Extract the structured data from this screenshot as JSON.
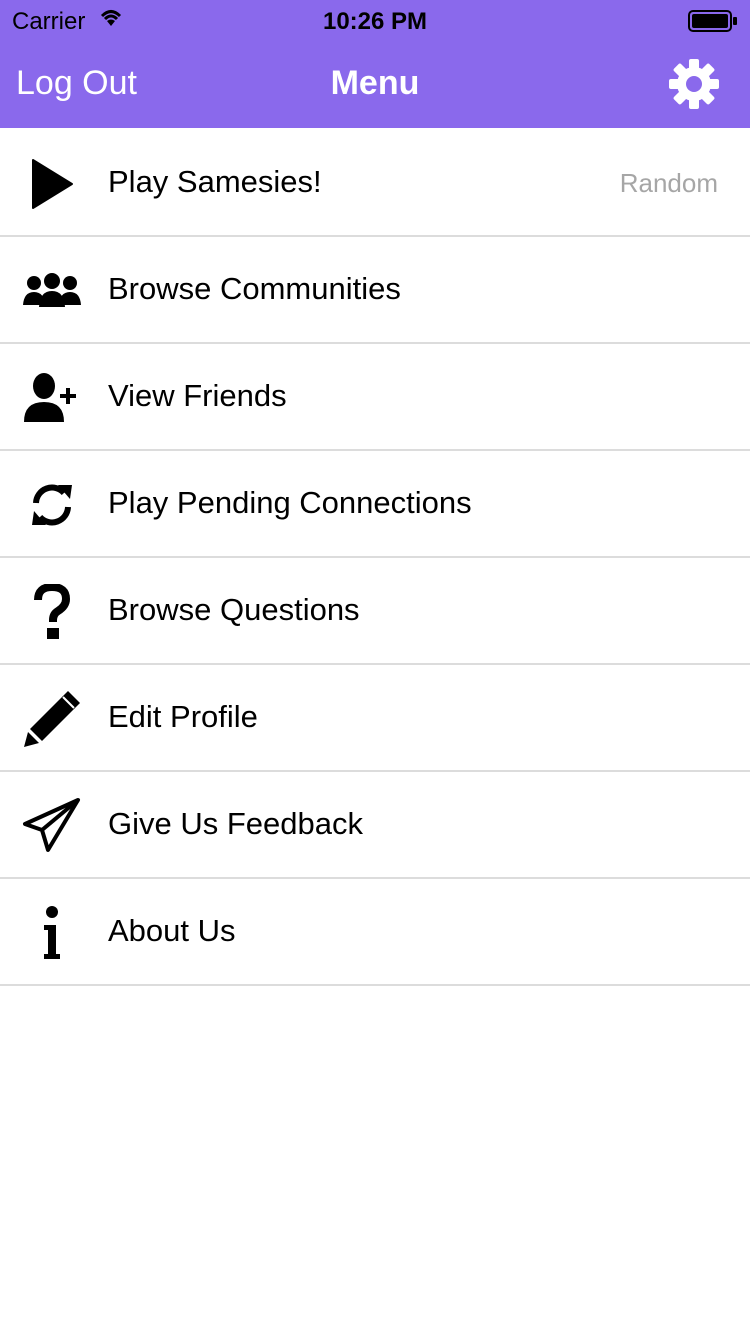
{
  "status_bar": {
    "carrier": "Carrier",
    "time": "10:26 PM"
  },
  "nav_bar": {
    "logout_label": "Log Out",
    "title": "Menu",
    "settings_icon": "gear-icon",
    "background": "#8a69ec"
  },
  "menu": {
    "items": [
      {
        "label": "Play Samesies!",
        "detail": "Random",
        "icon": "play-icon"
      },
      {
        "label": "Browse Communities",
        "icon": "group-icon"
      },
      {
        "label": "View Friends",
        "icon": "add-user-icon"
      },
      {
        "label": "Play Pending Connections",
        "icon": "refresh-icon"
      },
      {
        "label": "Browse Questions",
        "icon": "question-icon"
      },
      {
        "label": "Edit Profile",
        "icon": "pencil-icon"
      },
      {
        "label": "Give Us Feedback",
        "icon": "paper-plane-icon"
      },
      {
        "label": "About Us",
        "icon": "info-icon"
      }
    ]
  }
}
